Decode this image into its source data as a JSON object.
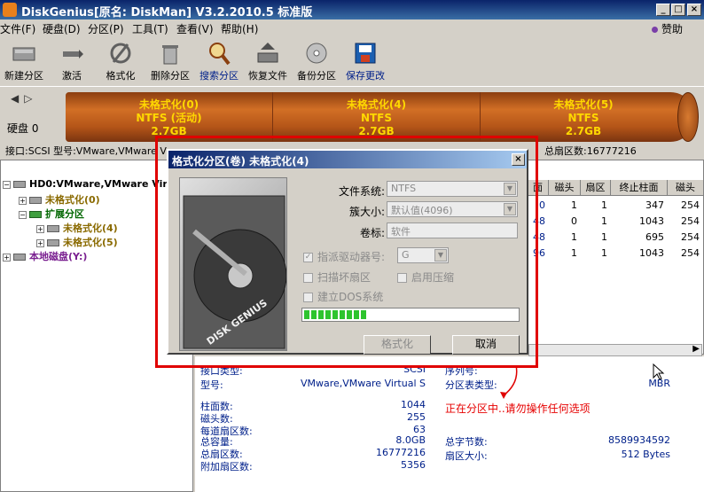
{
  "window": {
    "title": "DiskGenius[原名: DiskMan] V3.2.2010.5 标准版"
  },
  "menu": [
    "文件(F)",
    "硬盘(D)",
    "分区(P)",
    "工具(T)",
    "查看(V)",
    "帮助(H)"
  ],
  "help_link": "赞助",
  "toolbar": [
    {
      "label": "新建分区",
      "icon": "new-partition-icon"
    },
    {
      "label": "激活",
      "icon": "activate-icon"
    },
    {
      "label": "格式化",
      "icon": "format-icon"
    },
    {
      "label": "删除分区",
      "icon": "delete-partition-icon"
    },
    {
      "label": "搜索分区",
      "icon": "search-partition-icon"
    },
    {
      "label": "恢复文件",
      "icon": "recover-files-icon"
    },
    {
      "label": "备份分区",
      "icon": "backup-partition-icon"
    },
    {
      "label": "保存更改",
      "icon": "save-changes-icon"
    }
  ],
  "diskmap": {
    "disk_label": "硬盘 0",
    "partitions": [
      {
        "name": "未格式化(0)",
        "fs": "NTFS (活动)",
        "size": "2.7GB"
      },
      {
        "name": "未格式化(4)",
        "fs": "NTFS",
        "size": "2.7GB"
      },
      {
        "name": "未格式化(5)",
        "fs": "NTFS",
        "size": "2.7GB"
      }
    ]
  },
  "inforow": {
    "left": "接口:SCSI  型号:VMware,VMware V",
    "right": "总扇区数:16777216"
  },
  "tree": {
    "disk": "HD0:VMware,VMware Virt",
    "p0": "未格式化(0)",
    "ext": "扩展分区",
    "p4": "未格式化(4)",
    "p5": "未格式化(5)",
    "local": "本地磁盘(Y:)"
  },
  "table": {
    "headers": [
      "面",
      "磁头",
      "扇区",
      "终止柱面",
      "磁头"
    ],
    "rows": [
      [
        "0",
        "1",
        "1",
        "347",
        "254"
      ],
      [
        "48",
        "0",
        "1",
        "1043",
        "254"
      ],
      [
        "48",
        "1",
        "1",
        "695",
        "254"
      ],
      [
        "96",
        "1",
        "1",
        "1043",
        "254"
      ]
    ]
  },
  "details": {
    "iface_label": "接口类型:",
    "iface_value": "SCSI",
    "serial_label": "序列号:",
    "model_label": "型号:",
    "model_value": "VMware,VMware Virtual S",
    "ptype_label": "分区表类型:",
    "ptype_value": "MBR",
    "rows": [
      {
        "label": "柱面数:",
        "value": "1044"
      },
      {
        "label": "磁头数:",
        "value": "255"
      },
      {
        "label": "每道扇区数:",
        "value": "63"
      },
      {
        "label": "总容量:",
        "value": "8.0GB"
      },
      {
        "label": "总扇区数:",
        "value": "16777216"
      },
      {
        "label": "附加扇区数:",
        "value": "5356"
      }
    ],
    "bytes_label": "总字节数:",
    "bytes_value": "8589934592",
    "sector_label": "扇区大小:",
    "sector_value": "512 Bytes",
    "warning": "正在分区中..请勿操作任何选项"
  },
  "dialog": {
    "title": "格式化分区(卷) 未格式化(4)",
    "fs_label": "文件系统:",
    "fs_value": "NTFS",
    "cluster_label": "簇大小:",
    "cluster_value": "默认值(4096)",
    "volume_label": "卷标:",
    "volume_value": "软件",
    "assign_drive": "指派驱动器号:",
    "drive_value": "G",
    "scan_bad": "扫描坏扇区",
    "compress": "启用压缩",
    "dos": "建立DOS系统",
    "image_text": "DISK GENIUS",
    "progress": 0.3,
    "format_btn": "格式化",
    "cancel_btn": "取消"
  }
}
